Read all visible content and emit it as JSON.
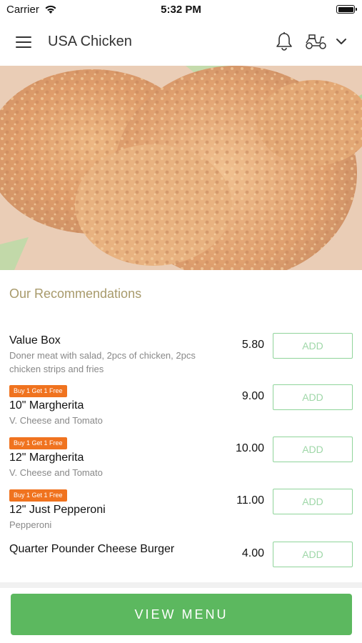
{
  "status_bar": {
    "carrier": "Carrier",
    "time": "5:32 PM"
  },
  "header": {
    "title": "USA Chicken",
    "icons": [
      "menu-icon",
      "bell-icon",
      "scooter-icon",
      "chevron-down-icon"
    ]
  },
  "section": {
    "title": "Our Recommendations"
  },
  "items": [
    {
      "name": "Value Box",
      "description": "Doner meat with salad, 2pcs of chicken, 2pcs chicken strips and fries",
      "price": "5.80",
      "badge": "",
      "add_label": "ADD"
    },
    {
      "name": "10\" Margherita",
      "description": "V. Cheese and Tomato",
      "price": "9.00",
      "badge": "Buy 1 Get 1 Free",
      "add_label": "ADD"
    },
    {
      "name": "12\" Margherita",
      "description": "V. Cheese and Tomato",
      "price": "10.00",
      "badge": "Buy 1 Get 1 Free",
      "add_label": "ADD"
    },
    {
      "name": "12\" Just Pepperoni",
      "description": "Pepperoni",
      "price": "11.00",
      "badge": "Buy 1 Get 1 Free",
      "add_label": "ADD"
    },
    {
      "name": "Quarter Pounder Cheese Burger",
      "description": "",
      "price": "4.00",
      "badge": "",
      "add_label": "ADD"
    }
  ],
  "footer": {
    "view_menu_label": "VIEW MENU"
  },
  "colors": {
    "accent_green": "#5cb85f",
    "badge_orange": "#f0731f",
    "section_title": "#a89a6b",
    "add_border": "#8fd49a"
  }
}
